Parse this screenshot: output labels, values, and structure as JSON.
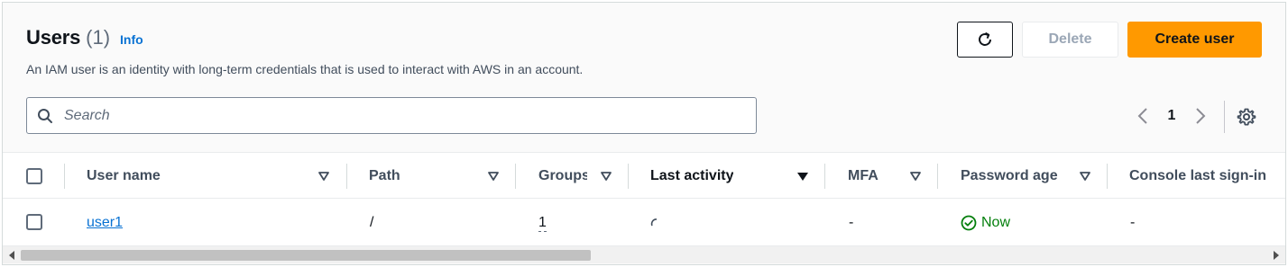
{
  "header": {
    "title": "Users",
    "count": "(1)",
    "info_link": "Info",
    "description": "An IAM user is an identity with long-term credentials that is used to interact with AWS in an account."
  },
  "actions": {
    "refresh_icon": "refresh-icon",
    "delete_label": "Delete",
    "create_label": "Create user"
  },
  "search": {
    "placeholder": "Search",
    "value": ""
  },
  "pagination": {
    "current_page": "1"
  },
  "table": {
    "columns": [
      {
        "label": "User name",
        "sort_icon": "caret-down-outline"
      },
      {
        "label": "Path",
        "sort_icon": "caret-down-outline"
      },
      {
        "label": "Groups",
        "sort_icon": "caret-down-outline"
      },
      {
        "label": "Last activity",
        "sort_icon": "caret-down-filled"
      },
      {
        "label": "MFA",
        "sort_icon": "caret-down-outline"
      },
      {
        "label": "Password age",
        "sort_icon": "caret-down-outline"
      },
      {
        "label": "Console last sign-in",
        "sort_icon": ""
      }
    ],
    "rows": [
      {
        "user_name": "user1",
        "path": "/",
        "groups": "1",
        "last_activity": "",
        "mfa": "-",
        "password_age": "Now",
        "console_last_sign_in": "-"
      }
    ]
  },
  "colors": {
    "accent": "#ff9900",
    "link": "#0972d3",
    "success": "#037f0c"
  }
}
